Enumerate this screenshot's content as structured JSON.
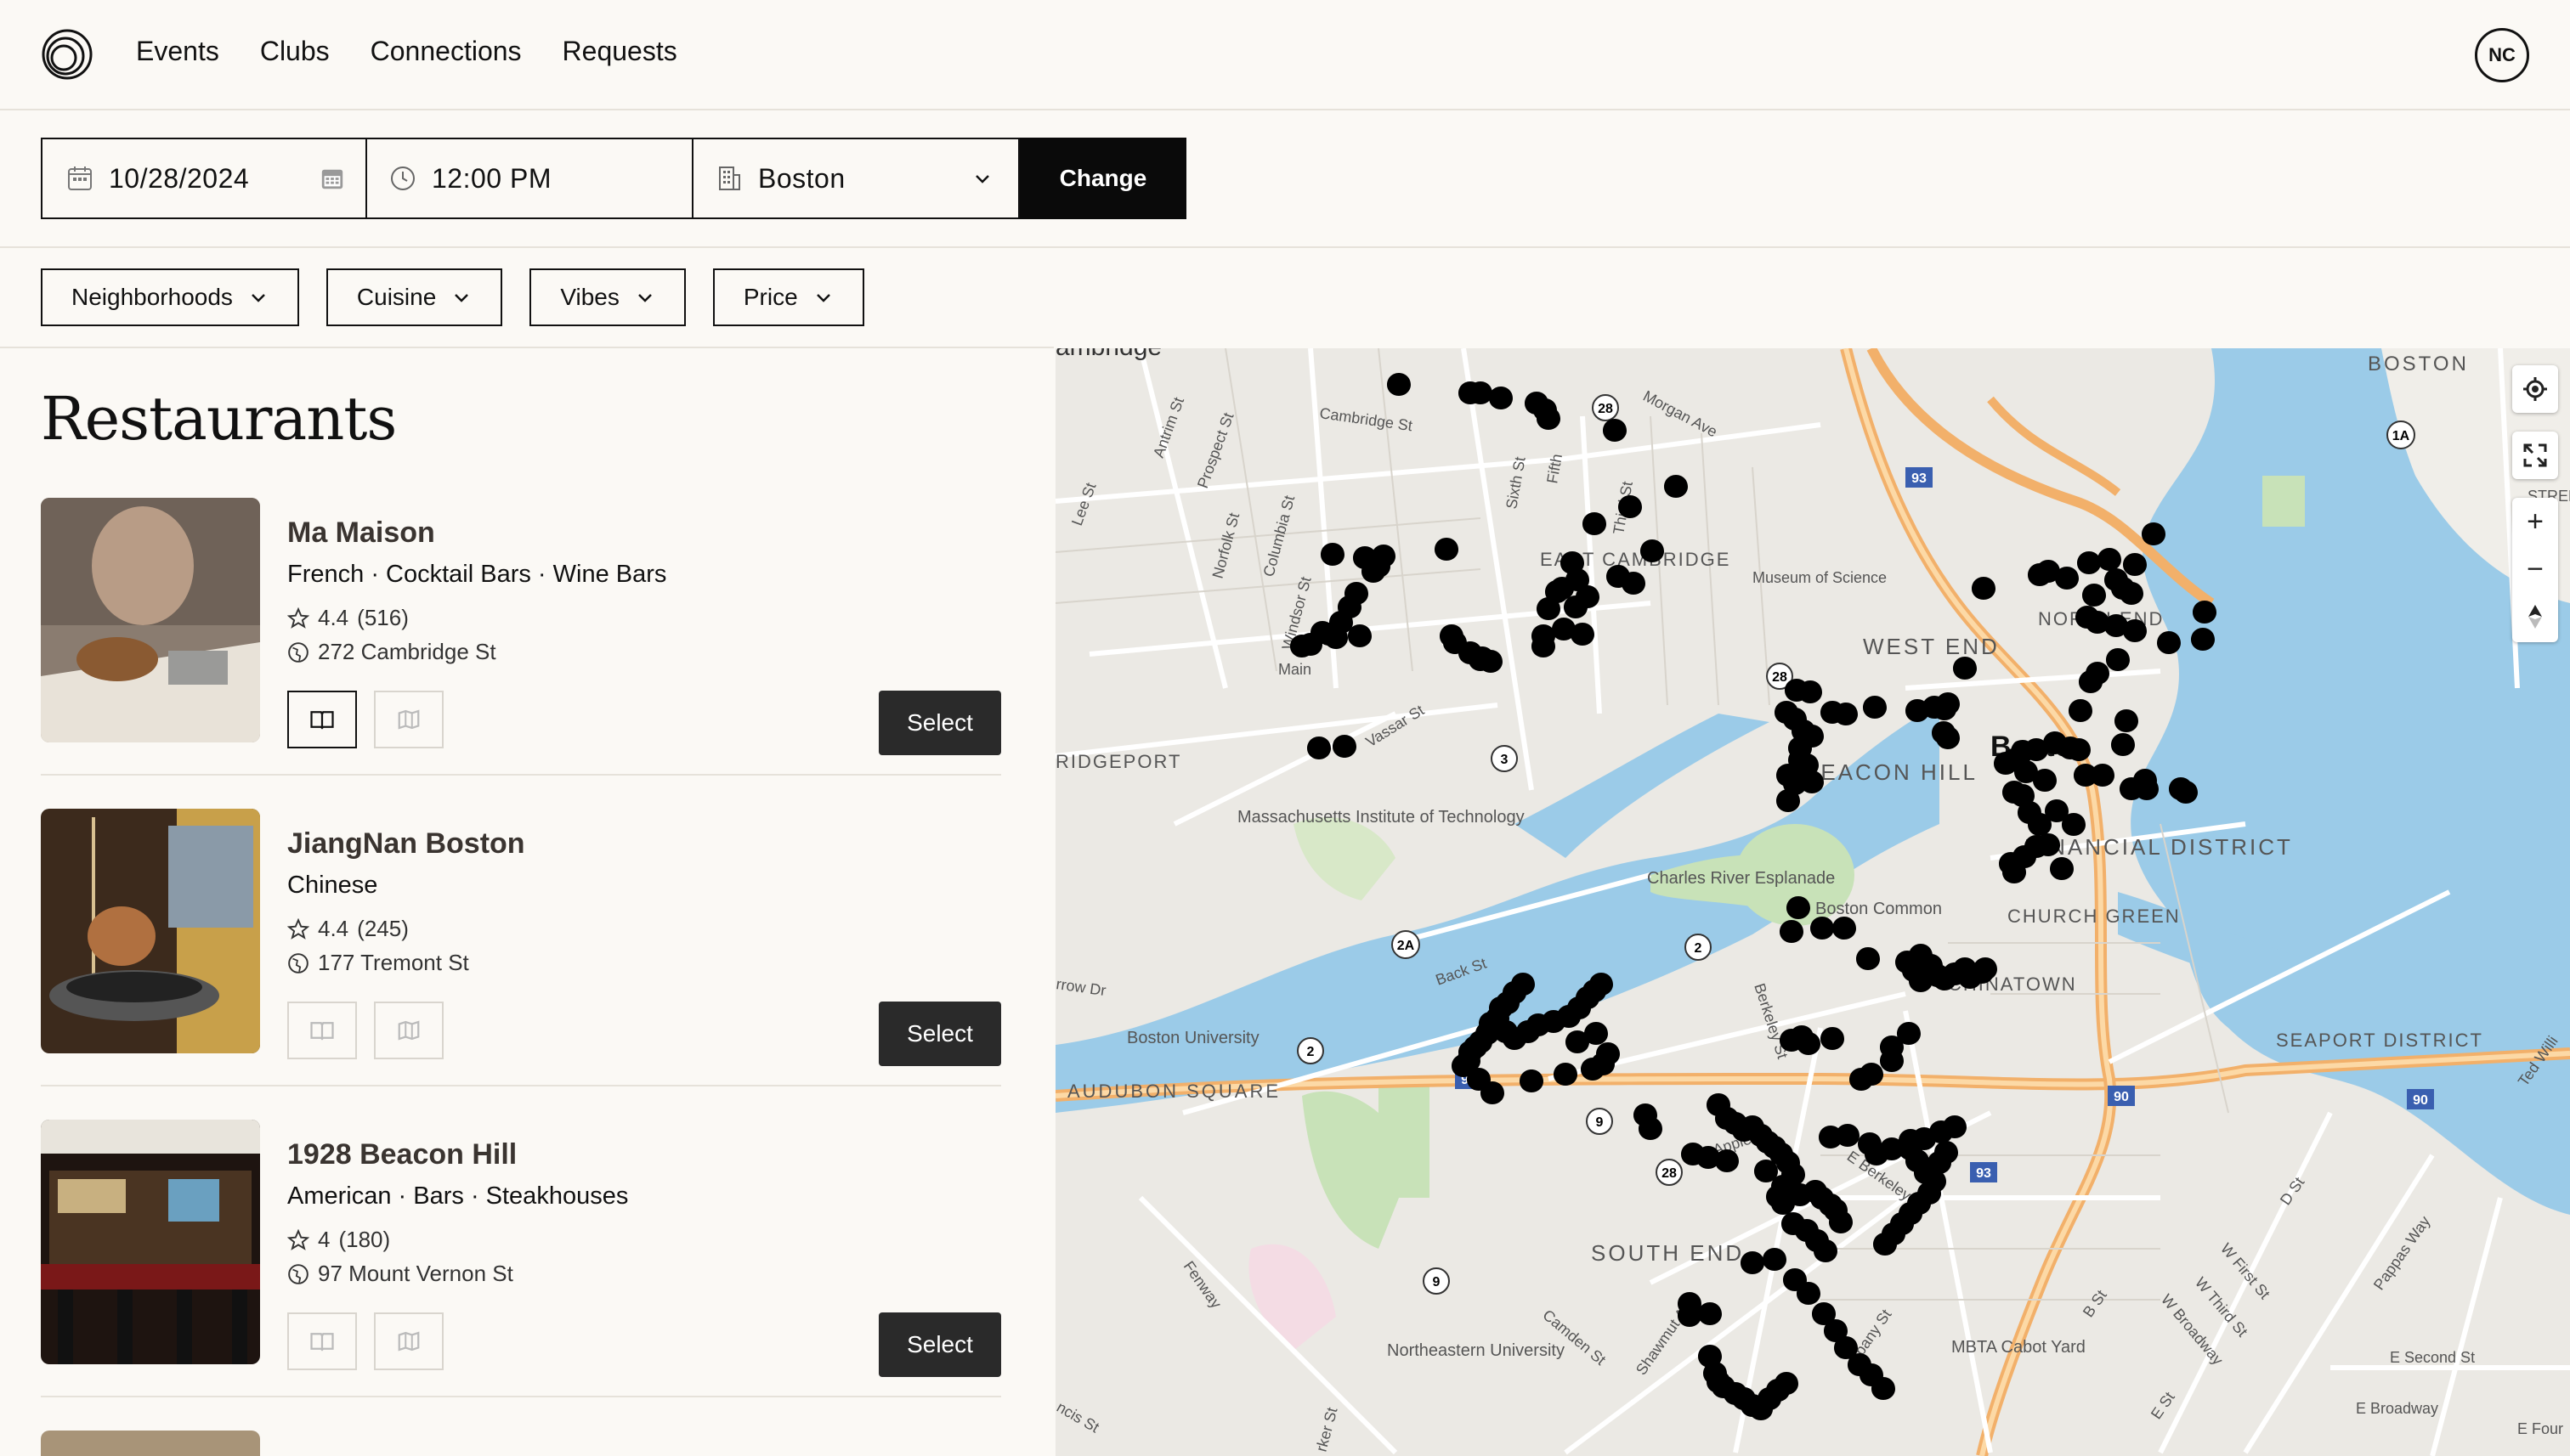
{
  "nav": {
    "links": [
      "Events",
      "Clubs",
      "Connections",
      "Requests"
    ],
    "avatar_initials": "NC"
  },
  "search": {
    "date": "10/28/2024",
    "time": "12:00 PM",
    "city": "Boston",
    "change_label": "Change"
  },
  "filters": [
    "Neighborhoods",
    "Cuisine",
    "Vibes",
    "Price"
  ],
  "list": {
    "title": "Restaurants",
    "restaurants": [
      {
        "name": "Ma Maison",
        "tags": "French · Cocktail Bars · Wine Bars",
        "rating": "4.4",
        "reviews": "(516)",
        "address": "272 Cambridge St",
        "select_label": "Select"
      },
      {
        "name": "JiangNan Boston",
        "tags": "Chinese",
        "rating": "4.4",
        "reviews": "(245)",
        "address": "177 Tremont St",
        "select_label": "Select"
      },
      {
        "name": "1928 Beacon Hill",
        "tags": "American · Bars · Steakhouses",
        "rating": "4",
        "reviews": "(180)",
        "address": "97 Mount Vernon St",
        "select_label": "Select"
      }
    ]
  },
  "map": {
    "labels": {
      "cambridge": "ambridge",
      "boston_top": "BOSTON",
      "east_cambridge": "EAST CAMBRIDGE",
      "museum": "Museum of Science",
      "west_end": "WEST END",
      "boston": "Boston",
      "beacon_hill": "BEACON HILL",
      "financial": "FINANCIAL DISTRICT",
      "church_green": "CHURCH GREEN",
      "mit": "Massachusetts Institute of Technology",
      "esplanade": "Charles River Esplanade",
      "common": "Boston Common",
      "chinatown": "CHINATOWN",
      "bu": "Boston University",
      "audubon": "AUDUBON SQUARE",
      "seaport": "SEAPORT DISTRICT",
      "south_end": "SOUTH END",
      "northeastern": "Northeastern University",
      "cabot": "MBTA Cabot Yard",
      "ridgeport": "RIDGEPORT",
      "north_end": "NORTH END",
      "cambridge_st": "Cambridge St",
      "morgan": "Morgan Ave",
      "vassar": "Vassar St",
      "back_st": "Back St",
      "berkeley": "Berkeley St",
      "appleton": "Appleton",
      "e_berkeley": "E Berkeley St",
      "albany": "Albany St",
      "fenway": "Fenway",
      "camden": "Camden St",
      "shawmut": "Shawmut Ave",
      "first_st": "W First St",
      "third_st": "W Third St",
      "broadway": "W Broadway",
      "e_broadway": "E Broadway",
      "e_second": "E Second St",
      "pappas": "Pappas Way",
      "ted": "Ted Willi",
      "d_st": "D St",
      "b_st": "B St",
      "e_st": "E St",
      "storrow": "rrow Dr",
      "main": "Main",
      "sixth": "Sixth St",
      "fifth": "Fifth",
      "third": "Third St",
      "windsor": "Windsor St",
      "columbia": "Columbia St",
      "norfolk": "Norfolk St",
      "prospect": "Prospect St",
      "antrim": "Antrim St",
      "lee": "Lee St",
      "e_four": "E Four",
      "street": "STREE",
      "parker": "rker St",
      "francis": "ncis St"
    },
    "shields": [
      "28",
      "93",
      "1A",
      "28",
      "3",
      "2A",
      "2",
      "2",
      "90",
      "90",
      "90",
      "93",
      "28",
      "9",
      "9"
    ]
  }
}
